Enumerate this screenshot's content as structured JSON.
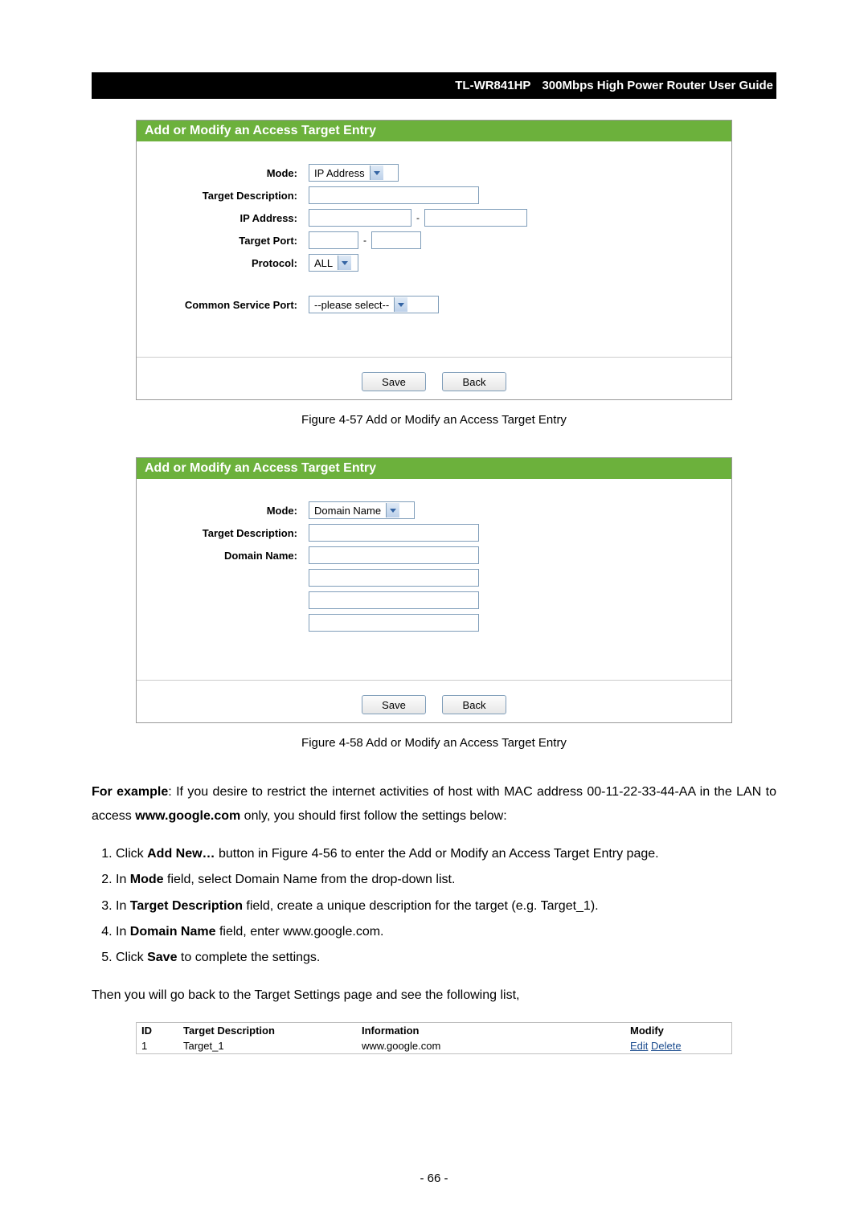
{
  "header": {
    "model": "TL-WR841HP",
    "subtitle": "300Mbps High Power Router User Guide"
  },
  "fig1": {
    "title": "Add or Modify an Access Target Entry",
    "labels": {
      "mode": "Mode:",
      "target_description": "Target Description:",
      "ip_address": "IP Address:",
      "target_port": "Target Port:",
      "protocol": "Protocol:",
      "common_service_port": "Common Service Port:"
    },
    "values": {
      "mode": "IP Address",
      "protocol": "ALL",
      "common_service_port": "--please select--"
    },
    "range_dash": "-",
    "buttons": {
      "save": "Save",
      "back": "Back"
    },
    "caption": "Figure 4-57    Add or Modify an Access Target Entry"
  },
  "fig2": {
    "title": "Add or Modify an Access Target Entry",
    "labels": {
      "mode": "Mode:",
      "target_description": "Target Description:",
      "domain_name": "Domain Name:"
    },
    "values": {
      "mode": "Domain Name"
    },
    "buttons": {
      "save": "Save",
      "back": "Back"
    },
    "caption": "Figure 4-58    Add or Modify an Access Target Entry"
  },
  "body": {
    "para1_prefix": "For example",
    "para1_rest": ": If you desire to restrict the internet activities of host with MAC address 00-11-22-33-44-AA in the LAN to access ",
    "para1_bold2": "www.google.com",
    "para1_tail": " only, you should first follow the settings below:"
  },
  "steps": {
    "s1a": "Click ",
    "s1b": "Add New…",
    "s1c": " button in Figure 4-56 to enter the Add or Modify an Access Target Entry page.",
    "s2a": "In ",
    "s2b": "Mode",
    "s2c": " field, select Domain Name from the drop-down list.",
    "s3a": "In ",
    "s3b": "Target Description",
    "s3c": " field, create a unique description for the target (e.g. Target_1).",
    "s4a": "In ",
    "s4b": "Domain Name",
    "s4c": " field, enter www.google.com.",
    "s5a": "Click ",
    "s5b": "Save",
    "s5c": " to complete the settings."
  },
  "after_steps": "Then you will go back to the Target Settings page and see the following list,",
  "table": {
    "headers": {
      "id": "ID",
      "desc": "Target Description",
      "info": "Information",
      "modify": "Modify"
    },
    "row": {
      "id": "1",
      "desc": "Target_1",
      "info": "www.google.com",
      "edit": "Edit",
      "delete": "Delete"
    }
  },
  "page_number": "- 66 -"
}
